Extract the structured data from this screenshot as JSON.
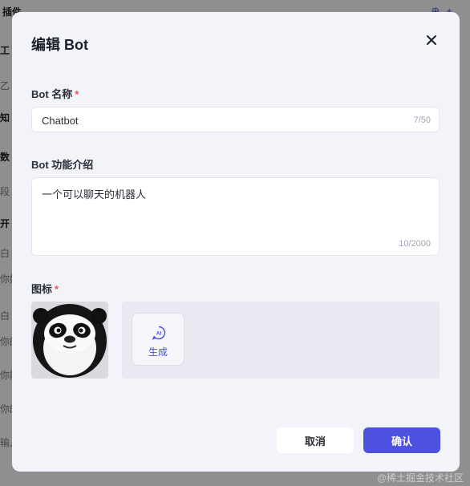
{
  "background": {
    "title": "插件",
    "rows": [
      {
        "label": "工",
        "bold": true
      },
      {
        "label": "乙",
        "bold": false
      },
      {
        "label": "知",
        "bold": true
      },
      {
        "label": "数",
        "bold": true
      },
      {
        "label": "段",
        "bold": false
      },
      {
        "label": "开",
        "bold": true
      },
      {
        "label": "白",
        "bold": false
      },
      {
        "label": "你好",
        "bold": false
      },
      {
        "label": "白",
        "bold": false
      },
      {
        "label": "你的",
        "bold": false
      },
      {
        "label": "你能",
        "bold": false
      },
      {
        "label": "你的",
        "bold": false
      },
      {
        "label": "输入",
        "bold": false
      }
    ]
  },
  "modal": {
    "title": "编辑 Bot",
    "close_icon": "close-icon",
    "name_field": {
      "label": "Bot 名称",
      "required": "*",
      "value": "Chatbot",
      "counter": "7/50"
    },
    "desc_field": {
      "label": "Bot 功能介绍",
      "value": "一个可以聊天的机器人",
      "counter": "10/2000"
    },
    "icon_field": {
      "label": "图标",
      "required": "*",
      "generate_label": "生成",
      "generate_icon": "ai-sparkle-icon"
    },
    "cancel_label": "取消",
    "confirm_label": "确认"
  },
  "colors": {
    "accent": "#4c52dd",
    "required": "#e2564b"
  },
  "watermark": "@稀土掘金技术社区"
}
